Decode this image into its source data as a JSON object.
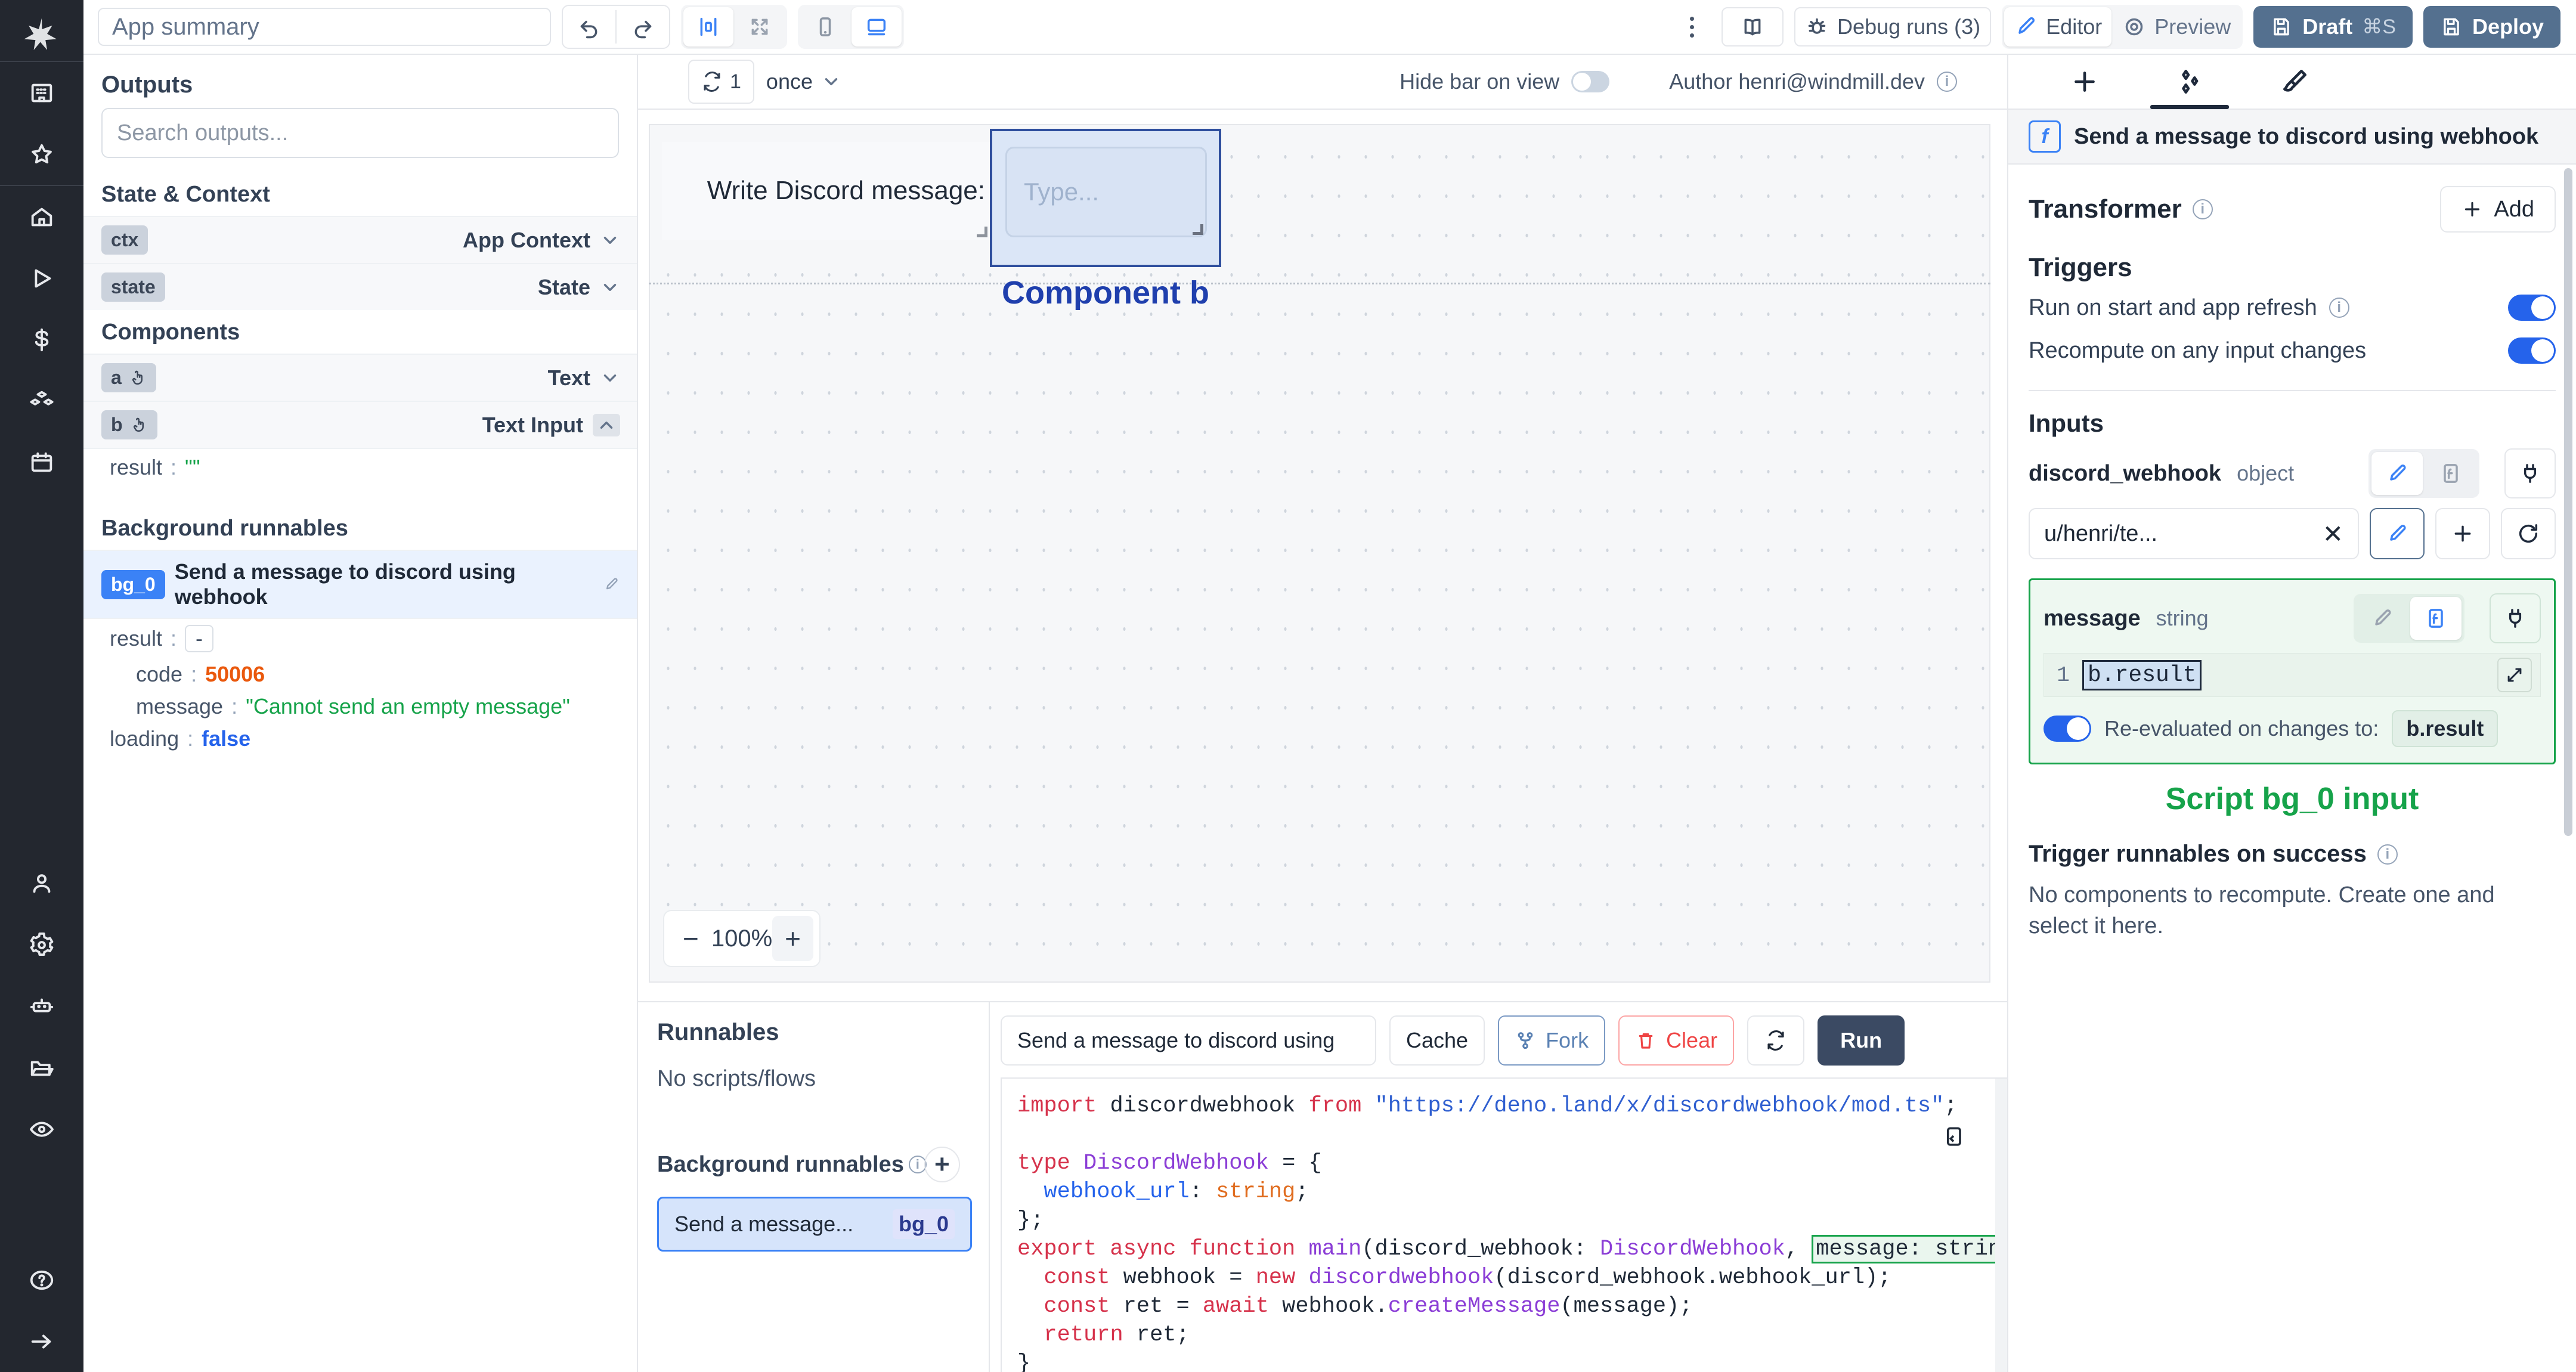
{
  "rail": {
    "logo": "windmill-logo",
    "items_top": [
      {
        "name": "workspace-icon",
        "label": "Workspace"
      },
      {
        "name": "star-icon",
        "label": "Favorites"
      }
    ],
    "items_main": [
      {
        "name": "home-icon",
        "label": "Home"
      },
      {
        "name": "runs-icon",
        "label": "Runs"
      },
      {
        "name": "dollar-icon",
        "label": "Usage"
      },
      {
        "name": "resources-icon",
        "label": "Resources"
      },
      {
        "name": "schedules-icon",
        "label": "Schedules"
      }
    ],
    "items_bottom": [
      {
        "name": "user-icon",
        "label": "Account"
      },
      {
        "name": "gear-icon",
        "label": "Settings"
      },
      {
        "name": "worker-icon",
        "label": "Workers"
      },
      {
        "name": "folder-icon",
        "label": "Folders"
      },
      {
        "name": "eye-icon",
        "label": "Audit logs"
      }
    ],
    "items_footer": [
      {
        "name": "help-icon",
        "label": "Help"
      },
      {
        "name": "expand-icon",
        "label": "Expand sidebar"
      }
    ]
  },
  "header": {
    "app_title": "App summary",
    "undo_label": "Undo",
    "redo_label": "Redo",
    "align_label": "Align center",
    "expand_label": "Expand",
    "mobile_label": "Mobile view",
    "desktop_label": "Desktop view",
    "more_label": "More",
    "docs_label": "Docs",
    "debug_runs_label": "Debug runs (3)",
    "editor_label": "Editor",
    "preview_label": "Preview",
    "draft_label": "Draft",
    "draft_shortcut": "⌘S",
    "deploy_label": "Deploy"
  },
  "outputs": {
    "title": "Outputs",
    "search_placeholder": "Search outputs...",
    "sections": [
      {
        "title": "State & Context",
        "rows": [
          {
            "id": "ctx",
            "label": "App Context"
          },
          {
            "id": "state",
            "label": "State"
          }
        ]
      }
    ],
    "components_title": "Components",
    "components": [
      {
        "id": "a",
        "label": "Text",
        "expanded": false
      },
      {
        "id": "b",
        "label": "Text Input",
        "expanded": true
      }
    ],
    "component_b_result_key": "result",
    "component_b_result_value": "\"\"",
    "bg_title": "Background runnables",
    "bg_id": "bg_0",
    "bg_label": "Send a message to discord using webhook",
    "bg_result_key": "result",
    "bg_result_value": "-",
    "bg_fields": [
      {
        "key": "code",
        "value": "50006",
        "kind": "num"
      },
      {
        "key": "message",
        "value": "\"Cannot send an empty message\"",
        "kind": "str"
      }
    ],
    "bg_loading_key": "loading",
    "bg_loading_value": "false"
  },
  "canvas_bar": {
    "refresh_count": "1",
    "interval_label": "once",
    "hide_bar_label": "Hide bar on view",
    "hide_bar_on": false,
    "author_label": "Author henri@windmill.dev"
  },
  "canvas": {
    "component_a_text": "Write Discord message:",
    "component_b_placeholder": "Type...",
    "selected_label": "Component b",
    "zoom_minus": "−",
    "zoom_value": "100%",
    "zoom_plus": "+"
  },
  "runnables": {
    "title": "Runnables",
    "empty": "No scripts/flows",
    "bg_header": "Background runnables",
    "add_label": "+",
    "item_name": "Send a message...",
    "item_id": "bg_0"
  },
  "editor": {
    "script_name": "Send a message to discord using",
    "cache_label": "Cache",
    "fork_label": "Fork",
    "clear_label": "Clear",
    "refresh_label": "Refresh",
    "run_label": "Run",
    "code_lines": [
      "import discordwebhook from \"https://deno.land/x/discordwebhook/mod.ts\";",
      "",
      "type DiscordWebhook = {",
      "  webhook_url: string;",
      "};",
      "export async function main(discord_webhook: DiscordWebhook, message: strin",
      "  const webhook = new discordwebhook(discord_webhook.webhook_url);",
      "  const ret = await webhook.createMessage(message);",
      "  return ret;",
      "}"
    ]
  },
  "right": {
    "tabs": [
      {
        "name": "tab-add",
        "icon": "plus-icon",
        "active": false
      },
      {
        "name": "tab-component",
        "icon": "components-icon",
        "active": true
      },
      {
        "name": "tab-style",
        "icon": "brush-icon",
        "active": false
      }
    ],
    "header_title": "Send a message to discord using webhook",
    "transformer_title": "Transformer",
    "add_label": "Add",
    "triggers_title": "Triggers",
    "triggers": [
      {
        "label": "Run on start and app refresh",
        "on": true,
        "info": true
      },
      {
        "label": "Recompute on any input changes",
        "on": true,
        "info": false
      }
    ],
    "inputs_title": "Inputs",
    "input_webhook": {
      "name": "discord_webhook",
      "type": "object",
      "value": "u/henri/te...",
      "clear_label": "✕",
      "edit_label": "edit",
      "add_label": "+",
      "refresh_label": "refresh"
    },
    "input_message": {
      "name": "message",
      "type": "string",
      "line_number": "1",
      "expression": "b.result",
      "reeval_label": "Re-evaluated on changes to:",
      "reeval_value": "b.result",
      "reeval_on": true
    },
    "caption": "Script bg_0 input",
    "trigger_success_title": "Trigger runnables on success",
    "trigger_success_note": "No components to recompute. Create one and select it here."
  },
  "colors": {
    "accent_blue": "#3b82f6",
    "deploy": "#54708f",
    "green": "#16a34a",
    "red": "#ef4444",
    "orange": "#ea580c",
    "rail": "#23272f"
  }
}
